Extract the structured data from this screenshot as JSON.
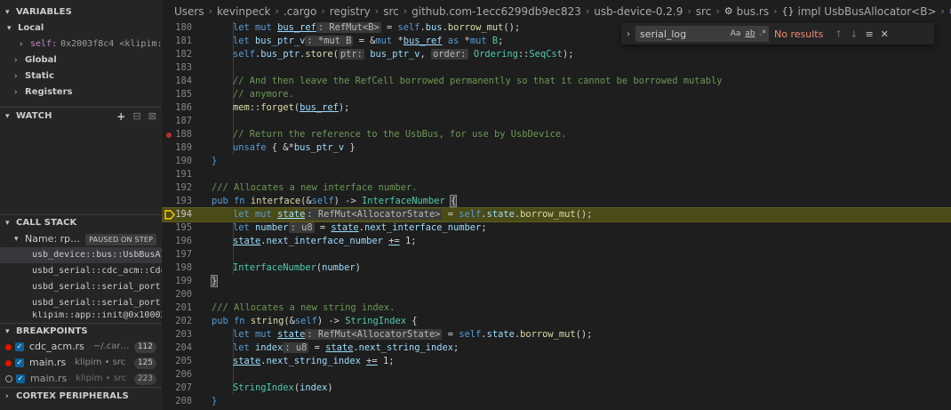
{
  "sidebar": {
    "variables": {
      "title": "VARIABLES",
      "local_label": "Local",
      "self_name": "self:",
      "self_value": "0x2003f8c4 <klipim:…",
      "scopes": [
        "Global",
        "Static",
        "Registers"
      ]
    },
    "watch": {
      "title": "WATCH",
      "add_icon": "+",
      "collapse_icon": "⊟",
      "remove_icon": "⊠"
    },
    "call_stack": {
      "title": "CALL STACK",
      "thread": "Name: rp…",
      "paused_badge": "PAUSED ON STEP",
      "frames": [
        "usb_device::bus::UsbBusAllo",
        "usbd_serial::cdc_acm::CdcAc",
        "usbd_serial::serial_port::S",
        "usbd_serial::serial_port::S",
        "klipim::app::init@0x100025c"
      ]
    },
    "breakpoints": {
      "title": "BREAKPOINTS",
      "items": [
        {
          "file": "cdc_acm.rs",
          "path": "~/.carg…",
          "line": "112"
        },
        {
          "file": "main.rs",
          "path": "klipim • src",
          "line": "125"
        },
        {
          "file": "main.rs",
          "path": "klipim • src",
          "line": "223"
        }
      ]
    },
    "cortex": {
      "title": "CORTEX PERIPHERALS"
    }
  },
  "breadcrumb": {
    "items": [
      "Users",
      "kevinpeck",
      ".cargo",
      "registry",
      "src",
      "github.com-1ecc6299db9ec823",
      "usb-device-0.2.9",
      "src",
      "bus.rs",
      "impl UsbBusAllocator<B>",
      "interface"
    ]
  },
  "find": {
    "value": "serial_log",
    "opt_case": "Aa",
    "opt_word": "ab",
    "opt_regex": ".*",
    "result": "No results",
    "prev_icon": "↑",
    "next_icon": "↓",
    "selection_icon": "≡",
    "close_icon": "✕"
  },
  "code": {
    "lines": [
      {
        "n": "180",
        "tokens": [
          [
            "kw",
            "let "
          ],
          [
            "kw",
            "mut "
          ],
          [
            "var ul",
            "bus_ref"
          ],
          [
            "hint",
            ": RefMut<B>"
          ],
          [
            "p",
            " = "
          ],
          [
            "kw",
            "self"
          ],
          [
            "p",
            "."
          ],
          [
            "var",
            "bus"
          ],
          [
            "p",
            "."
          ],
          [
            "fn",
            "borrow_mut"
          ],
          [
            "p",
            "();"
          ]
        ],
        "indent": 1
      },
      {
        "n": "181",
        "tokens": [
          [
            "kw",
            "let "
          ],
          [
            "var",
            "bus_ptr_v"
          ],
          [
            "hint",
            ": *mut B"
          ],
          [
            "p",
            " = &"
          ],
          [
            "kw",
            "mut "
          ],
          [
            "p",
            "*"
          ],
          [
            "var ul",
            "bus_ref"
          ],
          [
            "kw",
            " as "
          ],
          [
            "p",
            "*"
          ],
          [
            "kw",
            "mut "
          ],
          [
            "ty",
            "B"
          ],
          [
            "p",
            ";"
          ]
        ],
        "indent": 1
      },
      {
        "n": "182",
        "tokens": [
          [
            "kw",
            "self"
          ],
          [
            "p",
            "."
          ],
          [
            "var",
            "bus_ptr"
          ],
          [
            "p",
            "."
          ],
          [
            "fn",
            "store"
          ],
          [
            "p",
            "("
          ],
          [
            "hint",
            "ptr:"
          ],
          [
            "var",
            " bus_ptr_v"
          ],
          [
            "p",
            ", "
          ],
          [
            "hint",
            "order:"
          ],
          [
            "ty",
            " Ordering"
          ],
          [
            "p",
            "::"
          ],
          [
            "ty",
            "SeqCst"
          ],
          [
            "p",
            ");"
          ]
        ],
        "indent": 1
      },
      {
        "n": "183",
        "tokens": [],
        "indent": 1
      },
      {
        "n": "184",
        "tokens": [
          [
            "com",
            "// And then leave the RefCell borrowed permanently so that it cannot be borrowed mutably"
          ]
        ],
        "indent": 1
      },
      {
        "n": "185",
        "tokens": [
          [
            "com",
            "// anymore."
          ]
        ],
        "indent": 1
      },
      {
        "n": "186",
        "tokens": [
          [
            "fn",
            "mem"
          ],
          [
            "p",
            "::"
          ],
          [
            "fn",
            "forget"
          ],
          [
            "p",
            "("
          ],
          [
            "var ul",
            "bus_ref"
          ],
          [
            "p",
            ");"
          ]
        ],
        "indent": 1
      },
      {
        "n": "187",
        "tokens": [],
        "indent": 1
      },
      {
        "n": "188",
        "tokens": [
          [
            "com",
            "// Return the reference to the UsbBus, for use by UsbDevice."
          ]
        ],
        "indent": 1,
        "bp": true
      },
      {
        "n": "189",
        "tokens": [
          [
            "kw",
            "unsafe "
          ],
          [
            "p",
            "{ &*"
          ],
          [
            "var",
            "bus_ptr_v"
          ],
          [
            "p",
            " }"
          ]
        ],
        "indent": 1
      },
      {
        "n": "190",
        "tokens": [
          [
            "kw",
            "}"
          ]
        ],
        "indent": 0
      },
      {
        "n": "191",
        "tokens": [],
        "indent": 0
      },
      {
        "n": "192",
        "tokens": [
          [
            "com",
            "/// Allocates a new interface number."
          ]
        ],
        "indent": 0
      },
      {
        "n": "193",
        "tokens": [
          [
            "kw",
            "pub "
          ],
          [
            "kw",
            "fn "
          ],
          [
            "fn",
            "interface"
          ],
          [
            "p",
            "(&"
          ],
          [
            "kw",
            "self"
          ],
          [
            "p",
            ") -> "
          ],
          [
            "ty",
            "InterfaceNumber"
          ],
          [
            "p",
            " "
          ],
          [
            "bm",
            "{"
          ]
        ],
        "indent": 0
      },
      {
        "n": "194",
        "tokens": [
          [
            "kw",
            "let "
          ],
          [
            "kw",
            "mut "
          ],
          [
            "var ul",
            "state"
          ],
          [
            "hint",
            ": RefMut<AllocatorState>"
          ],
          [
            "p",
            " = "
          ],
          [
            "kw",
            "self"
          ],
          [
            "p",
            "."
          ],
          [
            "var",
            "state"
          ],
          [
            "p",
            "."
          ],
          [
            "fn",
            "borrow_mut"
          ],
          [
            "p",
            "();"
          ]
        ],
        "indent": 1,
        "current": true
      },
      {
        "n": "195",
        "tokens": [
          [
            "kw",
            "let "
          ],
          [
            "var",
            "number"
          ],
          [
            "hint",
            ": u8"
          ],
          [
            "p",
            " = "
          ],
          [
            "var ul",
            "state"
          ],
          [
            "p",
            "."
          ],
          [
            "var",
            "next_interface_number"
          ],
          [
            "p",
            ";"
          ]
        ],
        "indent": 1
      },
      {
        "n": "196",
        "tokens": [
          [
            "var ul",
            "state"
          ],
          [
            "p",
            "."
          ],
          [
            "var",
            "next_interface_number"
          ],
          [
            "p",
            " "
          ],
          [
            "p ul",
            "+="
          ],
          [
            "p",
            " 1;"
          ]
        ],
        "indent": 1
      },
      {
        "n": "197",
        "tokens": [],
        "indent": 1
      },
      {
        "n": "198",
        "tokens": [
          [
            "ty",
            "InterfaceNumber"
          ],
          [
            "p",
            "("
          ],
          [
            "var",
            "number"
          ],
          [
            "p",
            ")"
          ]
        ],
        "indent": 1
      },
      {
        "n": "199",
        "tokens": [
          [
            "bm",
            "}"
          ]
        ],
        "indent": 0
      },
      {
        "n": "200",
        "tokens": [],
        "indent": 0
      },
      {
        "n": "201",
        "tokens": [
          [
            "com",
            "/// Allocates a new string index."
          ]
        ],
        "indent": 0
      },
      {
        "n": "202",
        "tokens": [
          [
            "kw",
            "pub "
          ],
          [
            "kw",
            "fn "
          ],
          [
            "fn",
            "string"
          ],
          [
            "p",
            "(&"
          ],
          [
            "kw",
            "self"
          ],
          [
            "p",
            ") -> "
          ],
          [
            "ty",
            "StringIndex"
          ],
          [
            "p",
            " {"
          ]
        ],
        "indent": 0
      },
      {
        "n": "203",
        "tokens": [
          [
            "kw",
            "let "
          ],
          [
            "kw",
            "mut "
          ],
          [
            "var ul",
            "state"
          ],
          [
            "hint",
            ": RefMut<AllocatorState>"
          ],
          [
            "p",
            " = "
          ],
          [
            "kw",
            "self"
          ],
          [
            "p",
            "."
          ],
          [
            "var",
            "state"
          ],
          [
            "p",
            "."
          ],
          [
            "fn",
            "borrow_mut"
          ],
          [
            "p",
            "();"
          ]
        ],
        "indent": 1
      },
      {
        "n": "204",
        "tokens": [
          [
            "kw",
            "let "
          ],
          [
            "var",
            "index"
          ],
          [
            "hint",
            ": u8"
          ],
          [
            "p",
            " = "
          ],
          [
            "var ul",
            "state"
          ],
          [
            "p",
            "."
          ],
          [
            "var",
            "next_string_index"
          ],
          [
            "p",
            ";"
          ]
        ],
        "indent": 1
      },
      {
        "n": "205",
        "tokens": [
          [
            "var ul",
            "state"
          ],
          [
            "p",
            "."
          ],
          [
            "var",
            "next_string_index"
          ],
          [
            "p",
            " "
          ],
          [
            "p ul",
            "+="
          ],
          [
            "p",
            " 1;"
          ]
        ],
        "indent": 1
      },
      {
        "n": "206",
        "tokens": [],
        "indent": 1
      },
      {
        "n": "207",
        "tokens": [
          [
            "ty",
            "StringIndex"
          ],
          [
            "p",
            "("
          ],
          [
            "var",
            "index"
          ],
          [
            "p",
            ")"
          ]
        ],
        "indent": 1
      },
      {
        "n": "208",
        "tokens": [
          [
            "kw",
            "}"
          ]
        ],
        "indent": 0
      }
    ]
  },
  "colors": {
    "current_line": "#4b4b18",
    "breakpoint": "#e51400",
    "keyword": "#569cd6",
    "function": "#dcdcaa",
    "type": "#4ec9b0",
    "variable": "#9cdcfe",
    "comment": "#6a9955"
  }
}
